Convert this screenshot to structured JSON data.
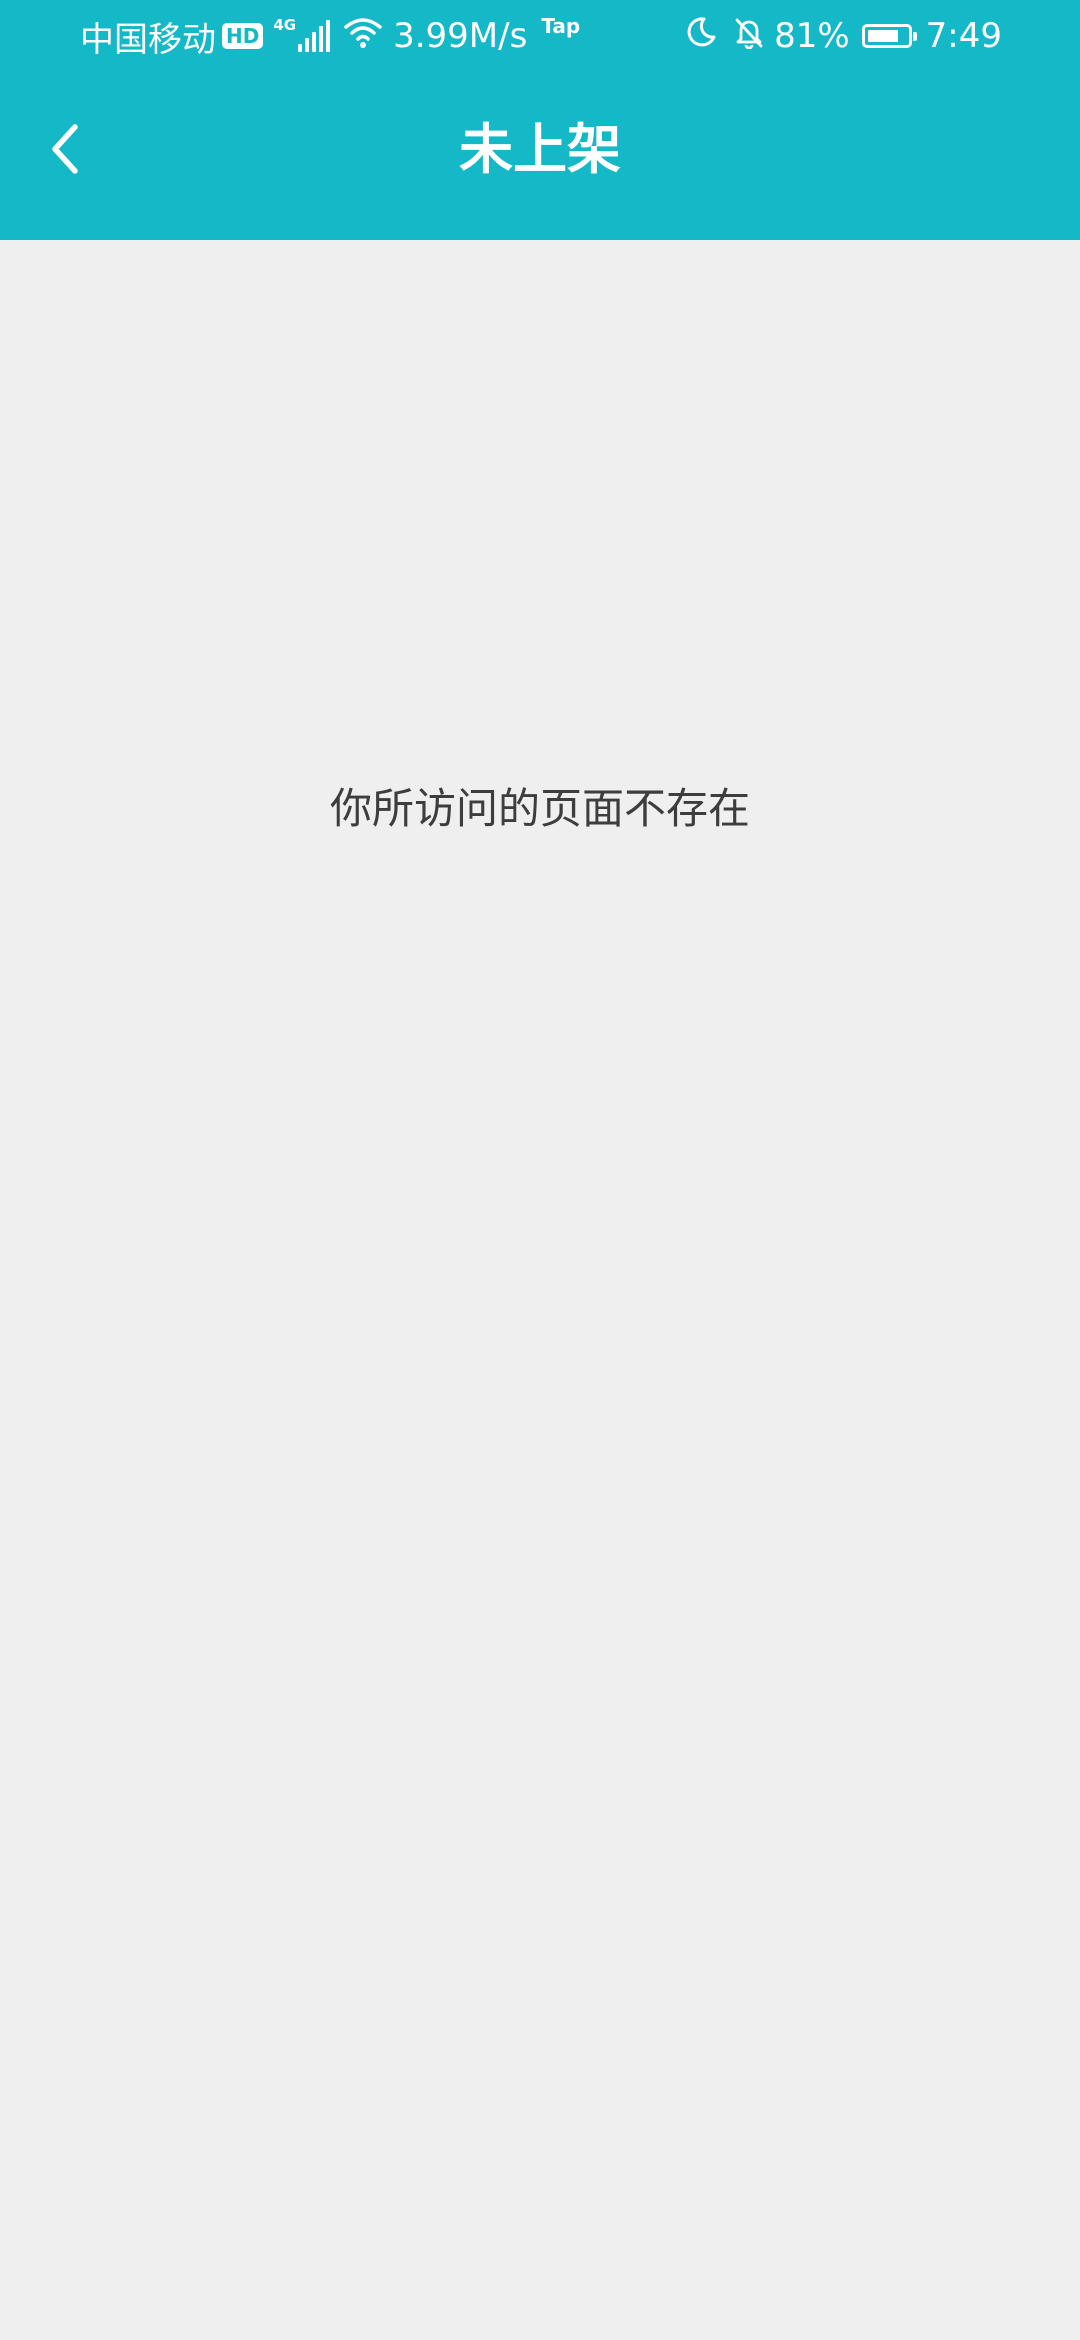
{
  "status_bar": {
    "carrier": "中国移动",
    "hd_label": "HD",
    "network_type": "4G",
    "speed": "3.99M/s",
    "tap_label": "Tap",
    "battery_percent": "81%",
    "battery_level": 0.81,
    "time": "7:49",
    "icons": [
      "signal-icon",
      "wifi-icon",
      "moon-icon",
      "bell-off-icon",
      "battery-icon"
    ]
  },
  "header": {
    "title": "未上架",
    "back_icon": "chevron-left-icon",
    "background_color": "#14b8c7"
  },
  "main": {
    "message": "你所访问的页面不存在",
    "background_color": "#efefef"
  }
}
